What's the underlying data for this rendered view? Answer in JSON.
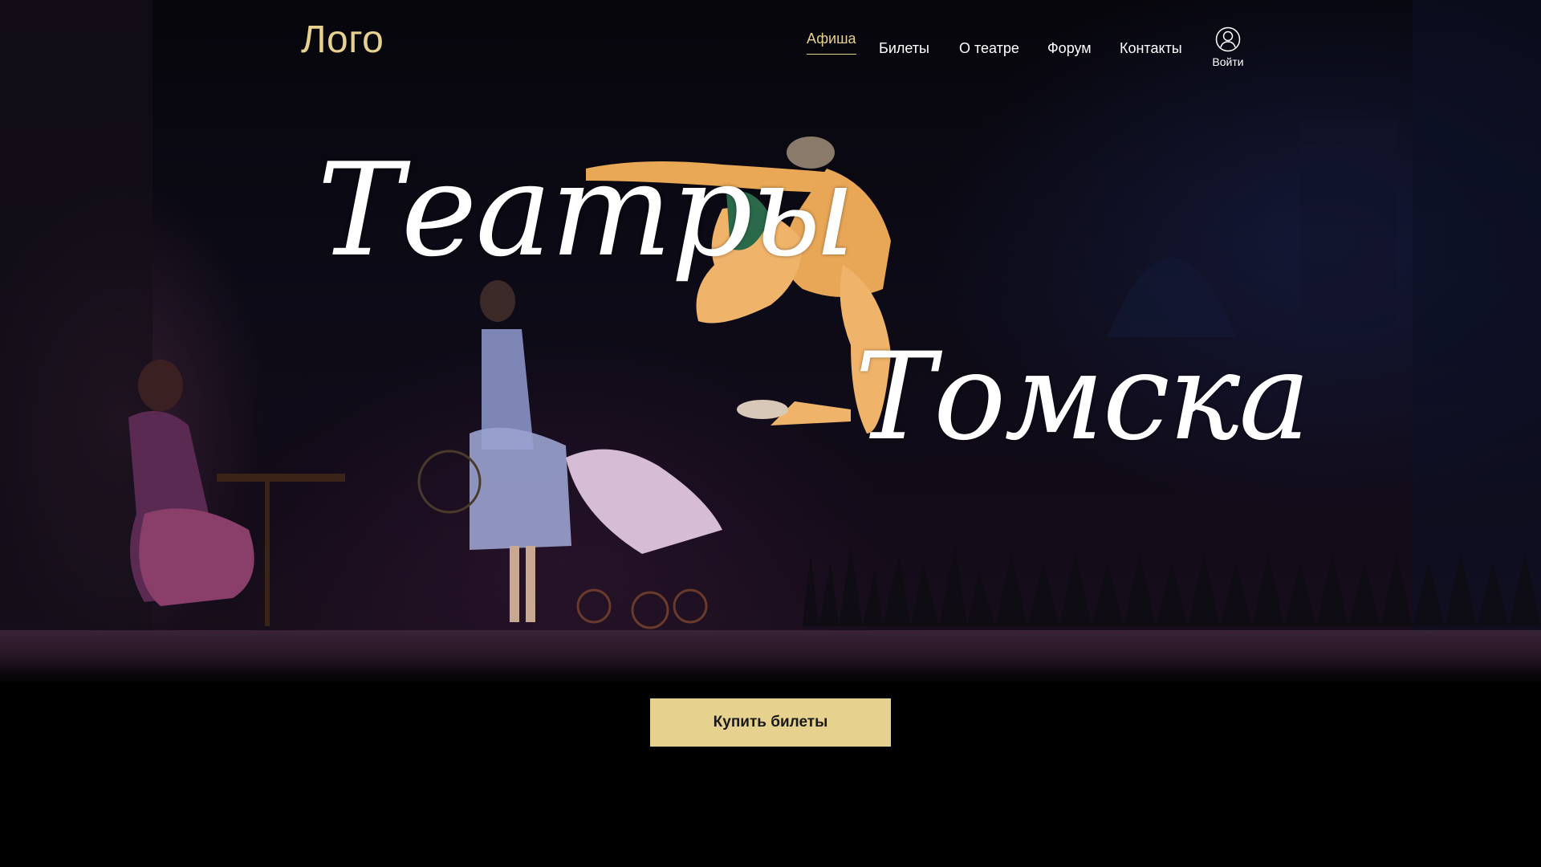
{
  "header": {
    "logo": "Лого",
    "nav": [
      {
        "label": "Афиша",
        "active": true
      },
      {
        "label": "Билеты",
        "active": false
      },
      {
        "label": "О театре",
        "active": false
      },
      {
        "label": "Форум",
        "active": false
      },
      {
        "label": "Контакты",
        "active": false
      }
    ],
    "login_label": "Войти",
    "login_icon": "user-icon"
  },
  "hero": {
    "title_line1": "Театры",
    "title_line2": "Томска",
    "background": "ballet stage scene photo"
  },
  "cta": {
    "label": "Купить билеты"
  },
  "colors": {
    "accent": "#e6d18e",
    "background": "#000000",
    "text": "#ffffff"
  }
}
